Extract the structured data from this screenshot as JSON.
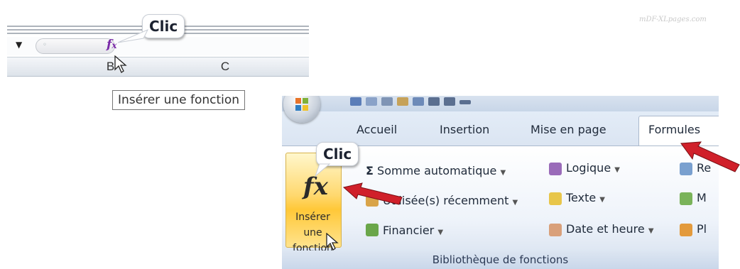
{
  "watermark": "mDF-XLpages.com",
  "formula_bar": {
    "namebox_dropdown_icon": "chevron-down-icon",
    "fx_label": "f",
    "fx_sub": "x",
    "columns": [
      "B",
      "C"
    ]
  },
  "callout_top": "Clic",
  "tooltip_text": "Insérer une fonction",
  "ribbon": {
    "tabs": [
      "Accueil",
      "Insertion",
      "Mise en page",
      "Formules"
    ],
    "active_tab": "Formules",
    "callout": "Clic",
    "big_button": {
      "icon": "fx",
      "label_line1": "Insérer une",
      "label_line2": "fonction"
    },
    "commands": {
      "somme": "Somme automatique",
      "utilisees": "Utilisée(s) récemment",
      "financier": "Financier",
      "logique": "Logique",
      "texte": "Texte",
      "date": "Date et heure",
      "re": "Re",
      "m": "M",
      "pl": "Pl"
    },
    "group_label": "Bibliothèque de fonctions"
  },
  "colors": {
    "accent_red": "#d0202a",
    "fx_purple": "#7a2aa8",
    "big_button_gold": "#ffc838",
    "ribbon_blue": "#dbe5f2"
  }
}
